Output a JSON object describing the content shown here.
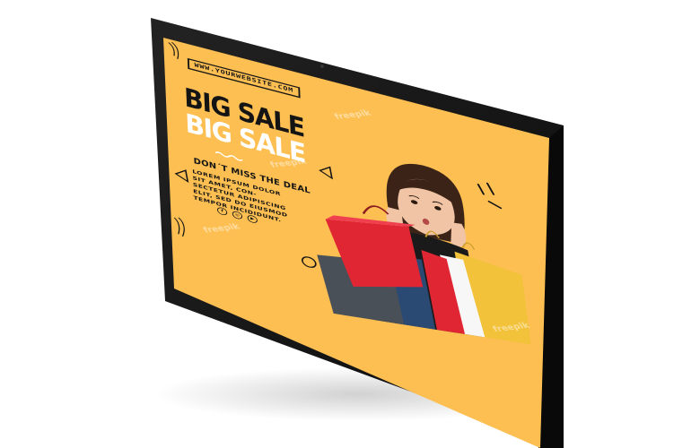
{
  "ad": {
    "website": "WWW.YOURWEBSITE.COM",
    "headline_primary": "BIG SALE",
    "headline_secondary": "BIG SALE",
    "tagline": "DON´T MISS THE DEAL",
    "body": "LOREM IPSUM DOLOR SIT AMET, CON-SECTETUR ADIPISCING ELIT, SED DO EIUSMOD TEMPOR INCIDIDUNT.",
    "socials": [
      {
        "icon": "facebook-icon",
        "glyph": "f"
      },
      {
        "icon": "instagram-icon",
        "glyph": "◎"
      },
      {
        "icon": "youtube-icon",
        "glyph": "▶"
      }
    ],
    "watermark": "freepik"
  },
  "colors": {
    "screen_yellow": "#fdbf52",
    "bezel": "#151515",
    "text_dark": "#141414",
    "text_light": "#ffffff",
    "bag_red": "#e02533",
    "bag_yellow": "#f2c23a",
    "bag_navy": "#2a4a73",
    "bag_gray": "#4a5058",
    "bag_white": "#f7f7f7"
  }
}
